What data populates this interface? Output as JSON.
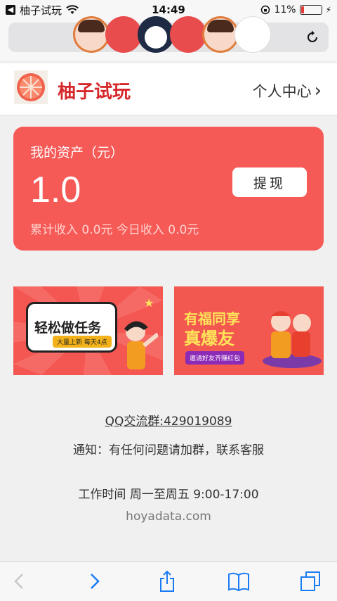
{
  "status_bar": {
    "back_app": "柚子试玩",
    "time": "14:49",
    "battery": "11%"
  },
  "browser": {
    "icons": [
      "reload-icon"
    ]
  },
  "header": {
    "title": "柚子试玩",
    "personal_center": "个人中心",
    "chevron": "›"
  },
  "assets": {
    "label": "我的资产（元）",
    "amount": "1.0",
    "withdraw": "提现",
    "cumulative_label": "累计收入",
    "cumulative_value": "0.0元",
    "today_label": "今日收入",
    "today_value": "0.0元"
  },
  "banners": {
    "easy_task": {
      "title": "轻松做任务",
      "subtitle": "大量上新 每天4点"
    },
    "share": {
      "title_line1": "有福同享",
      "title_line2": "真爆友",
      "subtitle": "邀请好友齐赚红包"
    }
  },
  "info": {
    "qq_group": "QQ交流群:429019089",
    "notice": "通知：有任何问题请加群，联系客服",
    "work_hours": "工作时间 周一至周五 9:00-17:00",
    "domain": "hoyadata.com"
  },
  "colors": {
    "brand_red": "#d6282b",
    "card_red": "#f55a57",
    "ios_blue": "#1a7cf5"
  }
}
